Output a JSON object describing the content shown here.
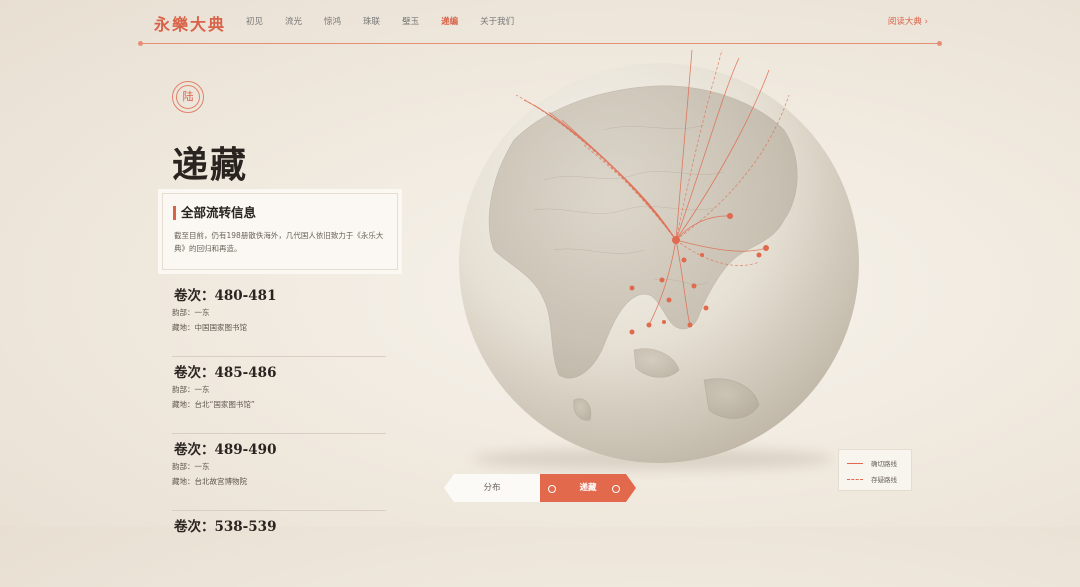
{
  "nav": {
    "logo": "永樂大典",
    "items": [
      "初见",
      "流光",
      "惊鸿",
      "珠联",
      "璧玉",
      "递编",
      "关于我们"
    ],
    "active_index": 5,
    "read_link": "阅读大典 ›"
  },
  "seal_char": "陆",
  "page_title": "递藏",
  "info": {
    "title": "全部流转信息",
    "desc": "截至目前，仍有198册散佚海外，几代国人依旧致力于《永乐大典》的回归和再造。"
  },
  "volumes": [
    {
      "title": "卷次：480-481",
      "dept": "韵部：一东",
      "place": "藏地：中国国家图书馆"
    },
    {
      "title": "卷次：485-486",
      "dept": "韵部：一东",
      "place": "藏地：台北“国家图书馆”"
    },
    {
      "title": "卷次：489-490",
      "dept": "韵部：一东",
      "place": "藏地：台北故宫博物院"
    },
    {
      "title": "卷次：538-539",
      "dept": "",
      "place": ""
    }
  ],
  "legend": {
    "solid_label": "确切路线",
    "dashed_label": "存疑路线"
  },
  "toggle": {
    "left": "分布",
    "right": "递藏"
  },
  "colors": {
    "accent": "#d9634a",
    "route": "#e0694e",
    "globe": "#e9e4da"
  }
}
